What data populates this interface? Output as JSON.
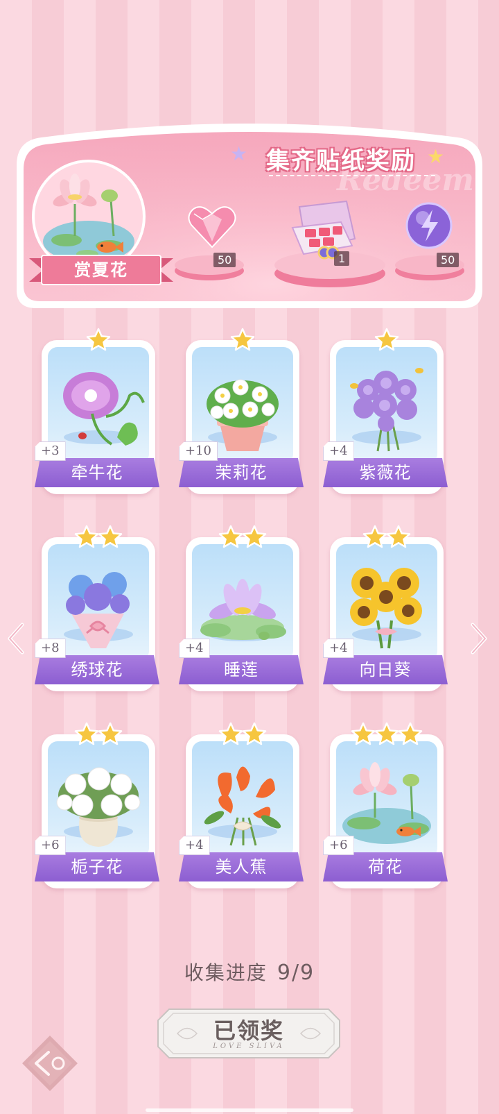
{
  "redeem": {
    "title": "集齐贴纸奖励",
    "watermark": "Redeem",
    "theme_label": "赏夏花",
    "rewards": [
      {
        "icon": "pink-heart-gem-icon",
        "count": "50"
      },
      {
        "icon": "gift-box-icon",
        "count": "1"
      },
      {
        "icon": "purple-energy-orb-icon",
        "count": "50"
      }
    ]
  },
  "flowers": [
    {
      "name": "牵牛花",
      "bonus": "+3",
      "stars": 1,
      "icon": "morning-glory-icon"
    },
    {
      "name": "茉莉花",
      "bonus": "+10",
      "stars": 1,
      "icon": "jasmine-pot-icon"
    },
    {
      "name": "紫薇花",
      "bonus": "+4",
      "stars": 1,
      "icon": "crape-myrtle-bouquet-icon"
    },
    {
      "name": "绣球花",
      "bonus": "+8",
      "stars": 2,
      "icon": "hydrangea-bouquet-icon"
    },
    {
      "name": "睡莲",
      "bonus": "+4",
      "stars": 2,
      "icon": "water-lily-icon"
    },
    {
      "name": "向日葵",
      "bonus": "+4",
      "stars": 2,
      "icon": "sunflower-bouquet-icon"
    },
    {
      "name": "栀子花",
      "bonus": "+6",
      "stars": 2,
      "icon": "gardenia-vase-icon"
    },
    {
      "name": "美人蕉",
      "bonus": "+4",
      "stars": 2,
      "icon": "canna-bouquet-icon"
    },
    {
      "name": "荷花",
      "bonus": "+6",
      "stars": 3,
      "icon": "lotus-pond-icon"
    }
  ],
  "progress": {
    "label": "收集进度",
    "value": "9/9"
  },
  "claim_button": {
    "label": "已领奖",
    "sub_label": "LOVE SLIVA"
  },
  "colors": {
    "accent_purple": "#8c5ed1",
    "panel_pink": "#f49ab3",
    "star_gold": "#f6c640"
  }
}
